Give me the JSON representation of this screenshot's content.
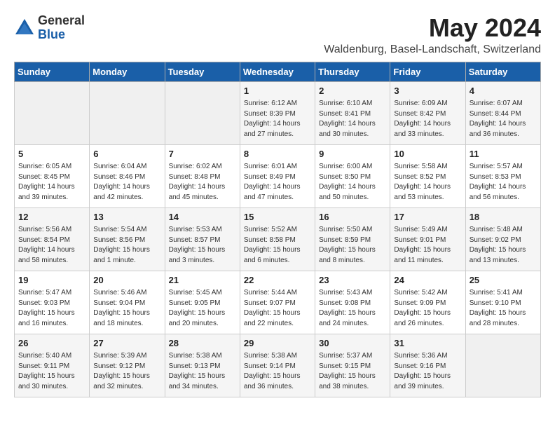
{
  "header": {
    "logo_line1": "General",
    "logo_line2": "Blue",
    "month": "May 2024",
    "location": "Waldenburg, Basel-Landschaft, Switzerland"
  },
  "weekdays": [
    "Sunday",
    "Monday",
    "Tuesday",
    "Wednesday",
    "Thursday",
    "Friday",
    "Saturday"
  ],
  "weeks": [
    [
      {
        "day": "",
        "info": ""
      },
      {
        "day": "",
        "info": ""
      },
      {
        "day": "",
        "info": ""
      },
      {
        "day": "1",
        "info": "Sunrise: 6:12 AM\nSunset: 8:39 PM\nDaylight: 14 hours and 27 minutes."
      },
      {
        "day": "2",
        "info": "Sunrise: 6:10 AM\nSunset: 8:41 PM\nDaylight: 14 hours and 30 minutes."
      },
      {
        "day": "3",
        "info": "Sunrise: 6:09 AM\nSunset: 8:42 PM\nDaylight: 14 hours and 33 minutes."
      },
      {
        "day": "4",
        "info": "Sunrise: 6:07 AM\nSunset: 8:44 PM\nDaylight: 14 hours and 36 minutes."
      }
    ],
    [
      {
        "day": "5",
        "info": "Sunrise: 6:05 AM\nSunset: 8:45 PM\nDaylight: 14 hours and 39 minutes."
      },
      {
        "day": "6",
        "info": "Sunrise: 6:04 AM\nSunset: 8:46 PM\nDaylight: 14 hours and 42 minutes."
      },
      {
        "day": "7",
        "info": "Sunrise: 6:02 AM\nSunset: 8:48 PM\nDaylight: 14 hours and 45 minutes."
      },
      {
        "day": "8",
        "info": "Sunrise: 6:01 AM\nSunset: 8:49 PM\nDaylight: 14 hours and 47 minutes."
      },
      {
        "day": "9",
        "info": "Sunrise: 6:00 AM\nSunset: 8:50 PM\nDaylight: 14 hours and 50 minutes."
      },
      {
        "day": "10",
        "info": "Sunrise: 5:58 AM\nSunset: 8:52 PM\nDaylight: 14 hours and 53 minutes."
      },
      {
        "day": "11",
        "info": "Sunrise: 5:57 AM\nSunset: 8:53 PM\nDaylight: 14 hours and 56 minutes."
      }
    ],
    [
      {
        "day": "12",
        "info": "Sunrise: 5:56 AM\nSunset: 8:54 PM\nDaylight: 14 hours and 58 minutes."
      },
      {
        "day": "13",
        "info": "Sunrise: 5:54 AM\nSunset: 8:56 PM\nDaylight: 15 hours and 1 minute."
      },
      {
        "day": "14",
        "info": "Sunrise: 5:53 AM\nSunset: 8:57 PM\nDaylight: 15 hours and 3 minutes."
      },
      {
        "day": "15",
        "info": "Sunrise: 5:52 AM\nSunset: 8:58 PM\nDaylight: 15 hours and 6 minutes."
      },
      {
        "day": "16",
        "info": "Sunrise: 5:50 AM\nSunset: 8:59 PM\nDaylight: 15 hours and 8 minutes."
      },
      {
        "day": "17",
        "info": "Sunrise: 5:49 AM\nSunset: 9:01 PM\nDaylight: 15 hours and 11 minutes."
      },
      {
        "day": "18",
        "info": "Sunrise: 5:48 AM\nSunset: 9:02 PM\nDaylight: 15 hours and 13 minutes."
      }
    ],
    [
      {
        "day": "19",
        "info": "Sunrise: 5:47 AM\nSunset: 9:03 PM\nDaylight: 15 hours and 16 minutes."
      },
      {
        "day": "20",
        "info": "Sunrise: 5:46 AM\nSunset: 9:04 PM\nDaylight: 15 hours and 18 minutes."
      },
      {
        "day": "21",
        "info": "Sunrise: 5:45 AM\nSunset: 9:05 PM\nDaylight: 15 hours and 20 minutes."
      },
      {
        "day": "22",
        "info": "Sunrise: 5:44 AM\nSunset: 9:07 PM\nDaylight: 15 hours and 22 minutes."
      },
      {
        "day": "23",
        "info": "Sunrise: 5:43 AM\nSunset: 9:08 PM\nDaylight: 15 hours and 24 minutes."
      },
      {
        "day": "24",
        "info": "Sunrise: 5:42 AM\nSunset: 9:09 PM\nDaylight: 15 hours and 26 minutes."
      },
      {
        "day": "25",
        "info": "Sunrise: 5:41 AM\nSunset: 9:10 PM\nDaylight: 15 hours and 28 minutes."
      }
    ],
    [
      {
        "day": "26",
        "info": "Sunrise: 5:40 AM\nSunset: 9:11 PM\nDaylight: 15 hours and 30 minutes."
      },
      {
        "day": "27",
        "info": "Sunrise: 5:39 AM\nSunset: 9:12 PM\nDaylight: 15 hours and 32 minutes."
      },
      {
        "day": "28",
        "info": "Sunrise: 5:38 AM\nSunset: 9:13 PM\nDaylight: 15 hours and 34 minutes."
      },
      {
        "day": "29",
        "info": "Sunrise: 5:38 AM\nSunset: 9:14 PM\nDaylight: 15 hours and 36 minutes."
      },
      {
        "day": "30",
        "info": "Sunrise: 5:37 AM\nSunset: 9:15 PM\nDaylight: 15 hours and 38 minutes."
      },
      {
        "day": "31",
        "info": "Sunrise: 5:36 AM\nSunset: 9:16 PM\nDaylight: 15 hours and 39 minutes."
      },
      {
        "day": "",
        "info": ""
      }
    ]
  ]
}
